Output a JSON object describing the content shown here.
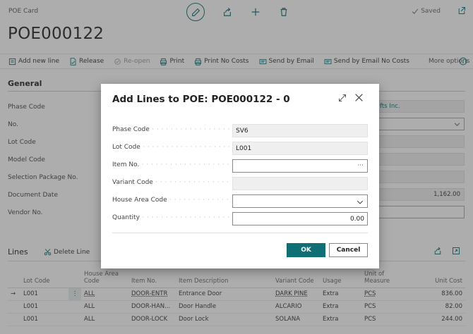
{
  "header": {
    "card_label": "POE Card",
    "saved_label": "Saved",
    "record_title": "POE000122"
  },
  "action_bar": {
    "items": [
      "Add new line",
      "Release",
      "Re-open",
      "Print",
      "Print No Costs",
      "Send by Email",
      "Send by Email No Costs"
    ],
    "more_options": "More options"
  },
  "general": {
    "title": "General",
    "labels": [
      "Phase Code",
      "No.",
      "Lot Code",
      "Model Code",
      "Selection Package No.",
      "Document Date",
      "Vendor No."
    ],
    "partial_value_phase": "fts Inc.",
    "partial_value_doc_amount": "1,162.00"
  },
  "lines": {
    "title": "Lines",
    "delete_label": "Delete Line",
    "columns": [
      "Lot Code",
      "House Area Code",
      "Item No.",
      "Item Description",
      "Variant Code",
      "Usage",
      "Unit of Measure",
      "Unit Cost"
    ],
    "rows": [
      {
        "lot": "L001",
        "area": "ALL",
        "item": "DOOR-ENTR",
        "desc": "Entrance Door",
        "variant": "DARK PINE",
        "usage": "Extra",
        "uom": "PCS",
        "cost": "836.00"
      },
      {
        "lot": "L001",
        "area": "ALL",
        "item": "DOOR-HAN...",
        "desc": "Door Handle",
        "variant": "ALCARIO",
        "usage": "Extra",
        "uom": "PCS",
        "cost": "82.00"
      },
      {
        "lot": "L001",
        "area": "ALL",
        "item": "DOOR-LOCK",
        "desc": "Door Lock",
        "variant": "SOLANA",
        "usage": "Extra",
        "uom": "PCS",
        "cost": "244.00"
      }
    ]
  },
  "dialog": {
    "title": "Add Lines to POE: POE000122 - 0",
    "fields": {
      "phase_code": {
        "label": "Phase Code",
        "value": "SV6"
      },
      "lot_code": {
        "label": "Lot Code",
        "value": "L001"
      },
      "item_no": {
        "label": "Item No.",
        "value": "",
        "trail": "···"
      },
      "variant_code": {
        "label": "Variant Code",
        "value": ""
      },
      "house_area_code": {
        "label": "House Area Code",
        "value": ""
      },
      "quantity": {
        "label": "Quantity",
        "value": "0.00"
      }
    },
    "ok_label": "OK",
    "cancel_label": "Cancel"
  },
  "colors": {
    "accent": "#0f6f74",
    "overlay": "#3c3c3c"
  }
}
